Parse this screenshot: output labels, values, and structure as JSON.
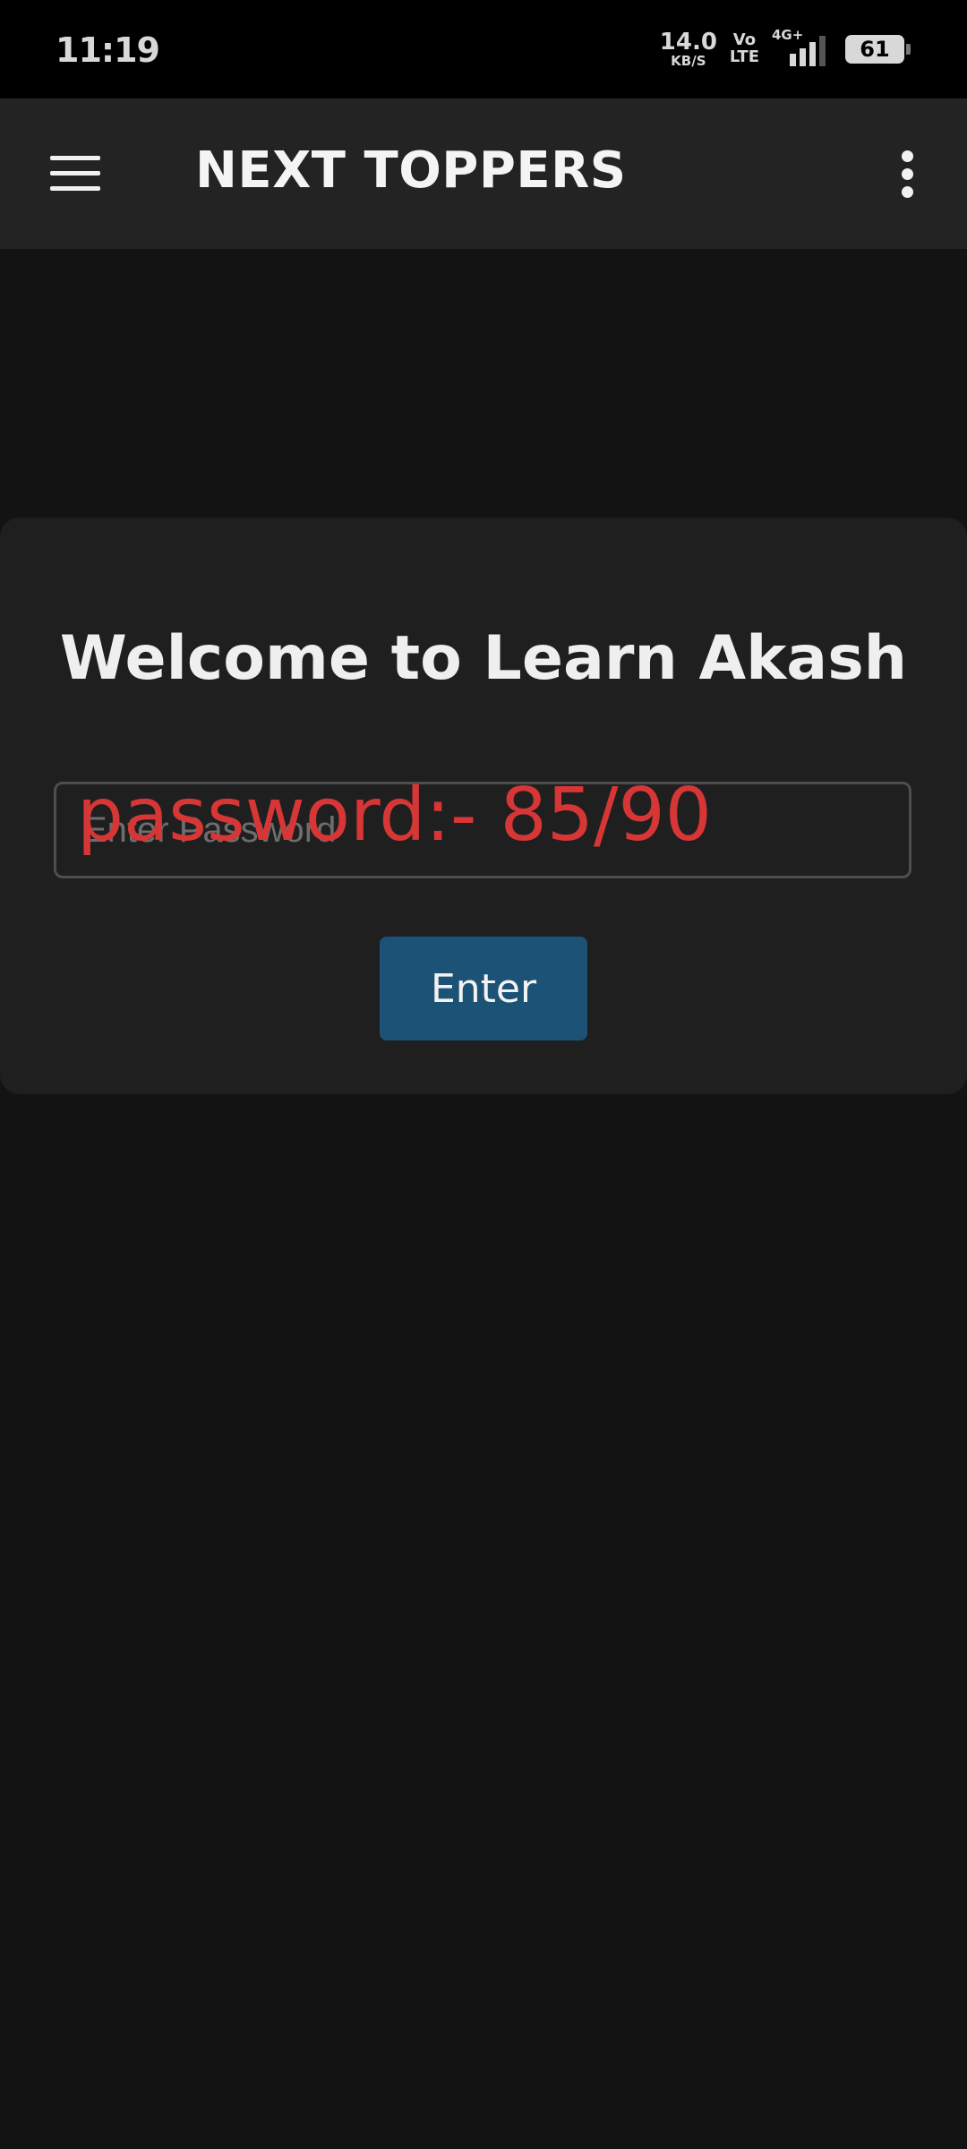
{
  "status_bar": {
    "time": "11:19",
    "net_speed_value": "14.0",
    "net_speed_unit": "KB/S",
    "volte_top": "Vo",
    "volte_bottom": "LTE",
    "network_type": "4G+",
    "battery_level": "61",
    "icons": [
      "signal-icon",
      "battery-icon"
    ]
  },
  "app_bar": {
    "title": "NEXT TOPPERS",
    "menu_icon": "hamburger-menu-icon",
    "more_icon": "more-vert-icon"
  },
  "login": {
    "heading": "Welcome to Learn Akash",
    "password_placeholder": "Enter Password",
    "password_value": "",
    "overlay_note": "password:- 85/90",
    "submit_label": "Enter"
  },
  "colors": {
    "background": "#131313",
    "status_bar": "#000000",
    "app_bar": "#232323",
    "card": "#1f1f1f",
    "button": "#1b5276",
    "overlay_text": "#d63636"
  }
}
